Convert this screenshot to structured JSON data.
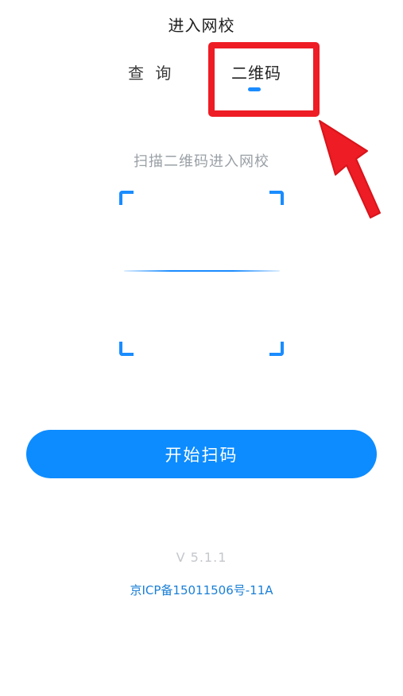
{
  "header": {
    "title": "进入网校"
  },
  "tabs": [
    {
      "label": "查 询",
      "selected": false
    },
    {
      "label": "二维码",
      "selected": true
    }
  ],
  "scan": {
    "hint": "扫描二维码进入网校"
  },
  "actions": {
    "start_scan_label": "开始扫码"
  },
  "footer": {
    "version": "V 5.1.1",
    "icp": "京ICP备15011506号-11A"
  },
  "colors": {
    "accent": "#0d8cff",
    "annotation_red": "#ee1c24",
    "hint_text": "#9aa0a6"
  },
  "annotations": {
    "highlight": "red-box-around-qr-tab",
    "pointer": "red-arrow-icon"
  }
}
